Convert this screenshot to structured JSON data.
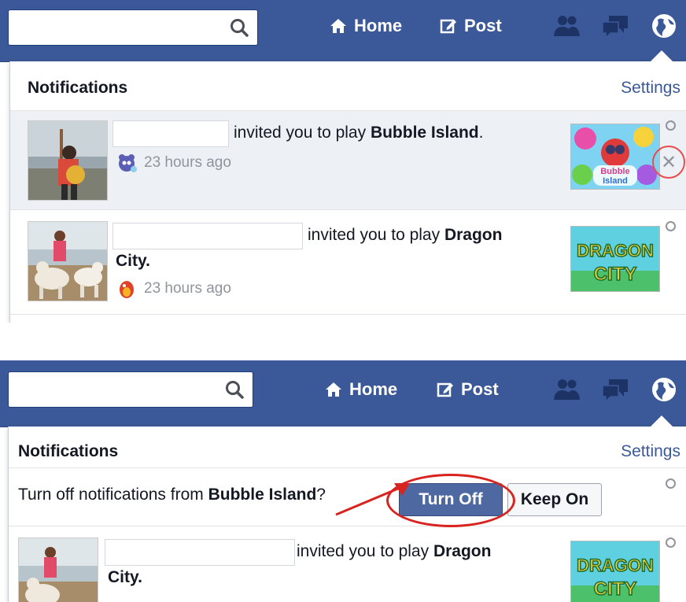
{
  "nav": {
    "home_label": "Home",
    "post_label": "Post"
  },
  "notifications_panel": {
    "title": "Notifications",
    "settings_label": "Settings"
  },
  "notifications": [
    {
      "text_prefix": "invited you to play ",
      "game": "Bubble Island",
      "suffix": ".",
      "time": "23 hours ago",
      "thumb_text_1": "Bubble",
      "thumb_text_2": "Island"
    },
    {
      "text_prefix": "invited you to play ",
      "game": "Dragon",
      "game_line2": "City.",
      "time": "23 hours ago",
      "thumb_text_1": "DRAGON",
      "thumb_text_2": "CITY"
    }
  ],
  "turn_off_prompt": {
    "text_prefix": "Turn off notifications from ",
    "app": "Bubble Island",
    "text_suffix": "?",
    "turn_off_label": "Turn Off",
    "keep_on_label": "Keep On"
  },
  "bottom_notification": {
    "text_prefix": "invited you to play ",
    "game": "Dragon",
    "game_line2": "City."
  },
  "colors": {
    "header_bg": "#3b5998",
    "accent_link": "#3b5998",
    "unread_bg": "#edf0f5",
    "annotation_red": "#d8231f"
  }
}
